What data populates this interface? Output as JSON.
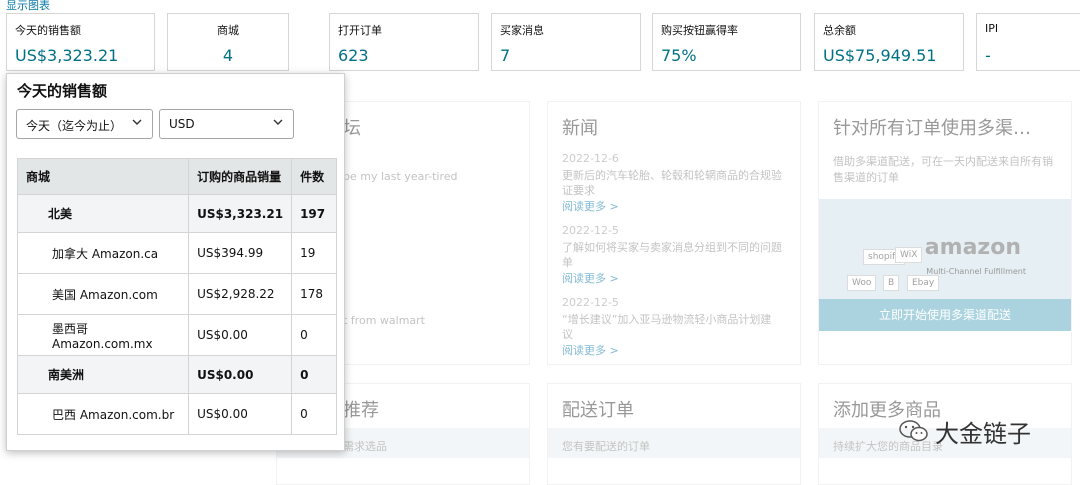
{
  "toplink": "显示图表",
  "metrics": [
    {
      "label": "今天的销售额",
      "value": "US$3,323.21"
    },
    {
      "label": "商城",
      "value": "4"
    },
    {
      "label": "打开订单",
      "value": "623"
    },
    {
      "label": "买家消息",
      "value": "7"
    },
    {
      "label": "购买按钮赢得率",
      "value": "75%"
    },
    {
      "label": "总余额",
      "value": "US$75,949.51"
    },
    {
      "label": "IPI",
      "value": "-"
    }
  ],
  "background": {
    "forum_title": "坛",
    "forum_line1": "be my last year-tired",
    "forum_line2": "t from walmart",
    "news": {
      "title": "新闻",
      "items": [
        {
          "date": "2022-12-6",
          "text": "更新后的汽车轮胎、轮毂和轮辋商品的合规验证要求",
          "link": "阅读更多 >"
        },
        {
          "date": "2022-12-5",
          "text": "了解如何将买家与卖家消息分组到不同的问题单",
          "link": "阅读更多 >"
        },
        {
          "date": "2022-12-5",
          "text": "“增长建议”加入亚马逊物流轻小商品计划建议",
          "link": "阅读更多 >"
        }
      ]
    },
    "mcf": {
      "title": "针对所有订单使用多渠…",
      "desc": "借助多渠道配送，可在一天内配送来自所有销售渠道的订单",
      "brand": "amazon",
      "sub": "Multi-Channel Fulfillment",
      "chips": [
        "shopify",
        "WiX",
        "Woo",
        "B",
        "Ebay"
      ],
      "cta": "立即开始使用多渠道配送"
    },
    "recommend_title": "推荐",
    "recommend_line": "需求选品",
    "ship_title": "配送订单",
    "ship_line": "您有要配送的订单",
    "add_title": "添加更多商品",
    "add_line": "持续扩大您的商品目录"
  },
  "popup": {
    "title": "今天的销售额",
    "period": "今天（迄今为止）",
    "currency": "USD",
    "headers": [
      "商城",
      "订购的商品销量",
      "件数"
    ],
    "rows": [
      {
        "name": "北美",
        "sales": "US$3,323.21",
        "units": "197",
        "region": true
      },
      {
        "name": "加拿大 Amazon.ca",
        "sales": "US$394.99",
        "units": "19",
        "region": false
      },
      {
        "name": "美国 Amazon.com",
        "sales": "US$2,928.22",
        "units": "178",
        "region": false
      },
      {
        "name": "墨西哥 Amazon.com.mx",
        "sales": "US$0.00",
        "units": "0",
        "region": false
      },
      {
        "name": "南美洲",
        "sales": "US$0.00",
        "units": "0",
        "region": true
      },
      {
        "name": "巴西 Amazon.com.br",
        "sales": "US$0.00",
        "units": "0",
        "region": false
      }
    ]
  },
  "watermark": "大金链子"
}
